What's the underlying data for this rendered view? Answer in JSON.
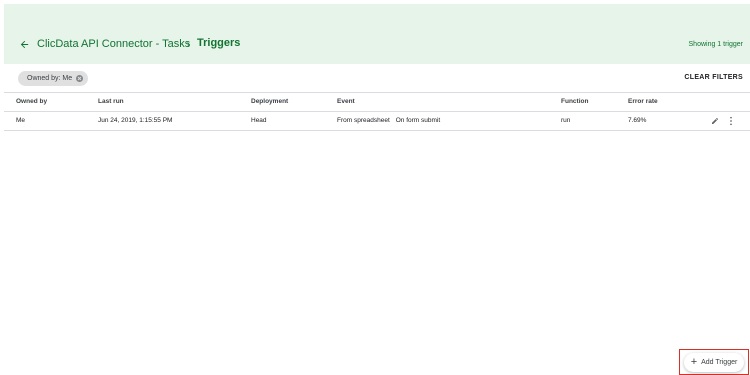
{
  "header": {
    "project_name": "ClicData API Connector - Tasks",
    "current_page": "Triggers",
    "showing": "Showing 1 trigger"
  },
  "filters": {
    "chip_label": "Owned by: Me",
    "clear_label": "CLEAR FILTERS"
  },
  "table": {
    "headers": {
      "owner": "Owned by",
      "last_run": "Last run",
      "deployment": "Deployment",
      "event": "Event",
      "function": "Function",
      "error_rate": "Error rate"
    },
    "rows": [
      {
        "owner": "Me",
        "last_run": "Jun 24, 2019, 1:15:55 PM",
        "deployment": "Head",
        "event_source": "From spreadsheet",
        "event_type": "On form submit",
        "function": "run",
        "error_rate": "7.69%"
      }
    ]
  },
  "actions": {
    "add_trigger": "Add Trigger"
  },
  "icons": {
    "back": "arrow-left-icon",
    "separator": "chevron-right-icon",
    "chip_close": "close-circle-icon",
    "edit": "pencil-icon",
    "more": "more-vert-icon",
    "add": "plus-icon"
  },
  "colors": {
    "header_bg": "#e6f4ea",
    "accent_green": "#137333",
    "highlight_red": "#d93025"
  }
}
